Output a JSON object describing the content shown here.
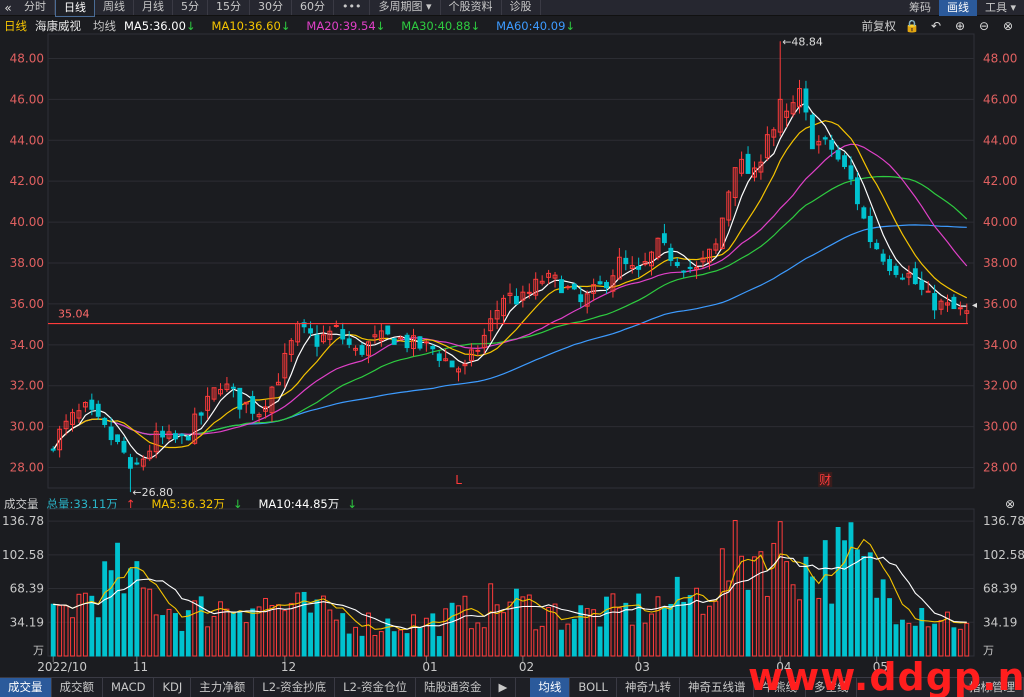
{
  "toolbar": {
    "back_icon": "double-chevron-left-icon",
    "tabs": [
      "分时",
      "日线",
      "周线",
      "月线",
      "5分",
      "15分",
      "30分",
      "60分",
      "•••",
      "多周期图 ▾",
      "个股资料",
      "诊股"
    ],
    "active_tab": 1,
    "right_tabs": [
      "筹码",
      "画线",
      "工具 ▾"
    ],
    "right_active": 1
  },
  "legend": {
    "period": "日线",
    "stock_name": "海康威视",
    "indicator": "均线",
    "ma": [
      {
        "label": "MA5:36.00",
        "arrow": "↓",
        "color": "#ffffff"
      },
      {
        "label": "MA10:36.60",
        "arrow": "↓",
        "color": "#f5c400"
      },
      {
        "label": "MA20:39.54",
        "arrow": "↓",
        "color": "#e040c8"
      },
      {
        "label": "MA30:40.88",
        "arrow": "↓",
        "color": "#2ecc40"
      },
      {
        "label": "MA60:40.09",
        "arrow": "↓",
        "color": "#3d9bff"
      }
    ],
    "adjust_label": "前复权",
    "icons": [
      "lock-icon",
      "undo-icon",
      "zoom-in-icon",
      "zoom-out-icon",
      "close-icon"
    ]
  },
  "volume_legend": {
    "title": "成交量",
    "total": {
      "label": "总量:33.11万",
      "arrow": "↑",
      "color": "#2ab5c9"
    },
    "ma5": {
      "label": "MA5:36.32万",
      "arrow": "↓",
      "color": "#f5c400"
    },
    "ma10": {
      "label": "MA10:44.85万",
      "arrow": "↓",
      "color": "#ffffff"
    },
    "close_icon": "close-icon"
  },
  "bottom_tabs": {
    "left": [
      "成交量",
      "成交额",
      "MACD",
      "KDJ",
      "主力净额",
      "L2-资金抄底",
      "L2-资金仓位",
      "陆股通资金"
    ],
    "left_active": 0,
    "arrow": "▶",
    "right": [
      "均线",
      "BOLL",
      "神奇九转",
      "神奇五线谱",
      "牛熊线",
      "多空线"
    ],
    "right_active": 0,
    "end": "指标管理"
  },
  "watermark": "www.ddgp.net",
  "colors": {
    "up": "#ff3b3b",
    "down": "#00c2cf",
    "grid": "#2c2d33",
    "axis_text": "#e06060",
    "background": "#1b1c20"
  },
  "chart_data": [
    {
      "type": "candlestick",
      "title": "",
      "yticks": [
        28.0,
        30.0,
        32.0,
        34.0,
        36.0,
        38.0,
        40.0,
        42.0,
        44.0,
        46.0,
        48.0
      ],
      "ylim": [
        27.0,
        49.0
      ],
      "xlabels": [
        "2022/10",
        "11",
        "12",
        "01",
        "02",
        "03",
        "04",
        "05"
      ],
      "n_days": 143,
      "label_days": [
        0,
        13,
        36,
        58,
        73,
        91,
        113,
        128
      ],
      "hline": {
        "value": 35.04,
        "label": "35.04"
      },
      "annotations": [
        {
          "text": "48.84",
          "value": 48.84,
          "day": 113
        },
        {
          "text": "26.80",
          "value": 26.8,
          "day": 12
        },
        {
          "text": "L",
          "day": 63,
          "color": "#ff3b3b"
        },
        {
          "text": "财",
          "day": 120,
          "color": "#ff3b3b"
        }
      ],
      "candles_anchor_close": [
        {
          "day": 0,
          "close": 29.3
        },
        {
          "day": 3,
          "close": 30.4
        },
        {
          "day": 5,
          "close": 30.8
        },
        {
          "day": 8,
          "close": 29.8
        },
        {
          "day": 11,
          "close": 28.7
        },
        {
          "day": 12,
          "close": 27.6
        },
        {
          "day": 16,
          "close": 29.4
        },
        {
          "day": 20,
          "close": 29.3
        },
        {
          "day": 23,
          "close": 30.6
        },
        {
          "day": 26,
          "close": 32.2
        },
        {
          "day": 29,
          "close": 31.2
        },
        {
          "day": 32,
          "close": 30.8
        },
        {
          "day": 35,
          "close": 32.5
        },
        {
          "day": 38,
          "close": 34.7
        },
        {
          "day": 41,
          "close": 34.2
        },
        {
          "day": 44,
          "close": 34.7
        },
        {
          "day": 47,
          "close": 33.6
        },
        {
          "day": 50,
          "close": 34.2
        },
        {
          "day": 53,
          "close": 34.4
        },
        {
          "day": 56,
          "close": 34.0
        },
        {
          "day": 59,
          "close": 33.8
        },
        {
          "day": 62,
          "close": 33.0
        },
        {
          "day": 64,
          "close": 32.8
        },
        {
          "day": 67,
          "close": 34.4
        },
        {
          "day": 70,
          "close": 36.4
        },
        {
          "day": 73,
          "close": 36.2
        },
        {
          "day": 76,
          "close": 37.2
        },
        {
          "day": 79,
          "close": 37.0
        },
        {
          "day": 82,
          "close": 36.0
        },
        {
          "day": 85,
          "close": 36.8
        },
        {
          "day": 88,
          "close": 38.0
        },
        {
          "day": 91,
          "close": 37.4
        },
        {
          "day": 94,
          "close": 38.8
        },
        {
          "day": 97,
          "close": 38.2
        },
        {
          "day": 100,
          "close": 37.6
        },
        {
          "day": 103,
          "close": 38.8
        },
        {
          "day": 106,
          "close": 43.0
        },
        {
          "day": 109,
          "close": 42.2
        },
        {
          "day": 111,
          "close": 44.5
        },
        {
          "day": 113,
          "close": 44.6
        },
        {
          "day": 116,
          "close": 46.2
        },
        {
          "day": 118,
          "close": 44.0
        },
        {
          "day": 121,
          "close": 43.6
        },
        {
          "day": 124,
          "close": 42.0
        },
        {
          "day": 127,
          "close": 39.2
        },
        {
          "day": 130,
          "close": 38.0
        },
        {
          "day": 133,
          "close": 37.4
        },
        {
          "day": 136,
          "close": 36.2
        },
        {
          "day": 139,
          "close": 35.8
        },
        {
          "day": 142,
          "close": 35.5
        }
      ],
      "ma_series_last": {
        "MA5": 36.0,
        "MA10": 36.6,
        "MA20": 39.54,
        "MA30": 40.88,
        "MA60": 40.09
      }
    },
    {
      "type": "bar",
      "title": "成交量",
      "unit": "万",
      "yticks": [
        34.19,
        68.39,
        102.58,
        136.78
      ],
      "ylim": [
        0,
        136.78
      ],
      "volume_anchor": [
        {
          "day": 0,
          "value": 40
        },
        {
          "day": 10,
          "value": 80
        },
        {
          "day": 20,
          "value": 42
        },
        {
          "day": 30,
          "value": 55
        },
        {
          "day": 40,
          "value": 45
        },
        {
          "day": 50,
          "value": 32
        },
        {
          "day": 60,
          "value": 35
        },
        {
          "day": 70,
          "value": 55
        },
        {
          "day": 80,
          "value": 40
        },
        {
          "day": 90,
          "value": 45
        },
        {
          "day": 100,
          "value": 60
        },
        {
          "day": 106,
          "value": 95
        },
        {
          "day": 112,
          "value": 110
        },
        {
          "day": 118,
          "value": 85
        },
        {
          "day": 124,
          "value": 100
        },
        {
          "day": 130,
          "value": 60
        },
        {
          "day": 136,
          "value": 45
        },
        {
          "day": 142,
          "value": 33.11
        }
      ]
    }
  ]
}
